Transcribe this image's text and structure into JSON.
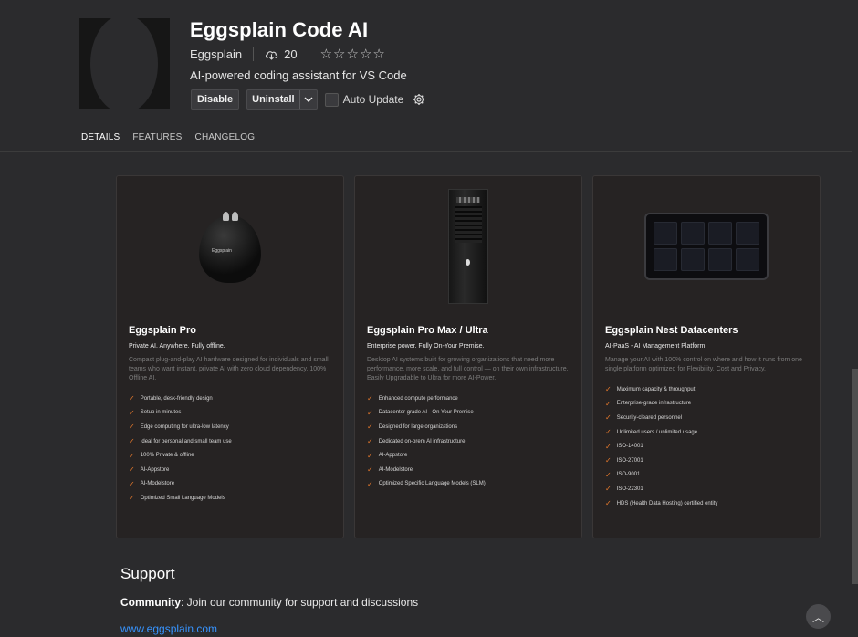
{
  "extension": {
    "title": "Eggsplain Code AI",
    "publisher": "Eggsplain",
    "installs": "20",
    "description": "AI-powered coding assistant for VS Code",
    "icons": {
      "installs": "cloud-download-icon",
      "rating": "star-icon",
      "settings": "gear-icon"
    },
    "rating_stars": [
      "☆",
      "☆",
      "☆",
      "☆",
      "☆"
    ]
  },
  "actions": {
    "disable": "Disable",
    "uninstall": "Uninstall",
    "uninstall_dropdown": "⌄",
    "auto_update": "Auto Update"
  },
  "tabs": [
    {
      "label": "DETAILS",
      "active": true
    },
    {
      "label": "FEATURES",
      "active": false
    },
    {
      "label": "CHANGELOG",
      "active": false
    }
  ],
  "cards": [
    {
      "title": "Eggsplain Pro",
      "subtitle": "Private AI. Anywhere. Fully offline.",
      "body": "Compact plug-and-play AI hardware designed for individuals and small teams who want instant, private AI with zero cloud dependency. 100% Offline AI.",
      "image_label": "Eggsplain",
      "features": [
        "Portable, desk-friendly design",
        "Setup in minutes",
        "Edge computing for ultra-low latency",
        "Ideal for personal and small team use",
        "100% Private & offline",
        "AI-Appstore",
        "AI-Modelstore",
        "Optimized Small Language Models"
      ]
    },
    {
      "title": "Eggsplain Pro Max / Ultra",
      "subtitle": "Enterprise power. Fully On-Your Premise.",
      "body": "Desktop AI systems built for growing organizations that need more performance, more scale, and full control — on their own infrastructure. Easily Upgradable to Ultra for more AI-Power.",
      "features": [
        "Enhanced compute performance",
        "Datacenter grade AI - On Your Premise",
        "Designed for large organizations",
        "Dedicated on-prem AI infrastructure",
        "AI-Appstore",
        "AI-Modelstore",
        "Optimized Specific Language Models (SLM)"
      ]
    },
    {
      "title": "Eggsplain Nest Datacenters",
      "subtitle": "AI-PaaS - AI Management Platform",
      "body": "Manage your AI with 100% control on where and how it runs from one single platform optimized for Flexibility, Cost and Privacy.",
      "features": [
        "Maximum capacity & throughput",
        "Enterprise-grade infrastructure",
        "Security-cleared personnel",
        "Unlimited users / unlimited usage",
        "ISO-14001",
        "ISO-27001",
        "ISO-9001",
        "ISO-22301",
        "HDS (Health Data Hosting) certified entity"
      ]
    }
  ],
  "support": {
    "heading": "Support",
    "community_label": "Community",
    "community_text": ": Join our community for support and discussions",
    "link": "www.eggsplain.com"
  },
  "check_glyph": "✓",
  "scroll_up_glyph": "︿"
}
